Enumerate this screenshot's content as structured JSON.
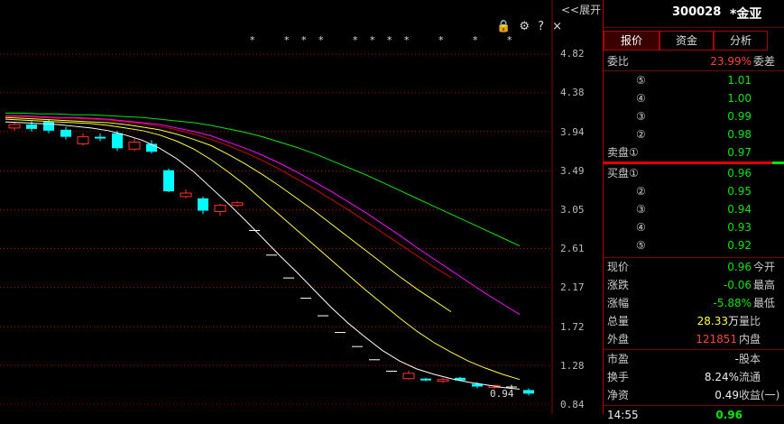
{
  "toolbar": {
    "collapse_label": "<<展开",
    "lock_icon": "lock-icon",
    "gear_icon": "gear-icon",
    "help_label": "?",
    "close_label": "×"
  },
  "markers": {
    "symbol": "*"
  },
  "price_axis": {
    "ticks": [
      "4.82",
      "4.38",
      "3.94",
      "3.49",
      "3.05",
      "2.61",
      "2.17",
      "1.72",
      "1.28",
      "0.84"
    ]
  },
  "last_price_label": "0.94",
  "colors": {
    "up": "#ff3030",
    "down": "#00ffff",
    "ma1": "#ffffff",
    "ma2": "#ffff33",
    "ma3": "#ff00ff",
    "ma4": "#00e600",
    "ma5": "#d00000"
  },
  "chart_data": {
    "type": "candlestick",
    "ylim": [
      0.84,
      4.82
    ],
    "y_ticks": [
      4.82,
      4.38,
      3.94,
      3.49,
      3.05,
      2.61,
      2.17,
      1.72,
      1.28,
      0.84
    ],
    "candles": [
      {
        "o": 3.98,
        "c": 4.02,
        "h": 4.05,
        "l": 3.95
      },
      {
        "o": 4.02,
        "c": 3.97,
        "h": 4.06,
        "l": 3.94
      },
      {
        "o": 4.05,
        "c": 3.95,
        "h": 4.08,
        "l": 3.92
      },
      {
        "o": 3.96,
        "c": 3.88,
        "h": 3.99,
        "l": 3.85
      },
      {
        "o": 3.8,
        "c": 3.88,
        "h": 3.92,
        "l": 3.78
      },
      {
        "o": 3.88,
        "c": 3.86,
        "h": 3.92,
        "l": 3.83
      },
      {
        "o": 3.92,
        "c": 3.75,
        "h": 3.95,
        "l": 3.72
      },
      {
        "o": 3.74,
        "c": 3.82,
        "h": 3.86,
        "l": 3.72
      },
      {
        "o": 3.8,
        "c": 3.71,
        "h": 3.84,
        "l": 3.69
      },
      {
        "o": 3.5,
        "c": 3.26,
        "h": 3.52,
        "l": 3.25
      },
      {
        "o": 3.2,
        "c": 3.24,
        "h": 3.28,
        "l": 3.18
      },
      {
        "o": 3.18,
        "c": 3.04,
        "h": 3.2,
        "l": 3.0
      },
      {
        "o": 3.03,
        "c": 3.1,
        "h": 3.12,
        "l": 2.98
      },
      {
        "o": 3.1,
        "c": 3.13,
        "h": 3.15,
        "l": 3.08
      },
      {
        "o": 2.82,
        "c": 2.82,
        "h": 2.82,
        "l": 2.82
      },
      {
        "o": 2.54,
        "c": 2.54,
        "h": 2.54,
        "l": 2.54
      },
      {
        "o": 2.28,
        "c": 2.28,
        "h": 2.28,
        "l": 2.28
      },
      {
        "o": 2.05,
        "c": 2.05,
        "h": 2.05,
        "l": 2.05
      },
      {
        "o": 1.85,
        "c": 1.85,
        "h": 1.85,
        "l": 1.85
      },
      {
        "o": 1.66,
        "c": 1.66,
        "h": 1.66,
        "l": 1.66
      },
      {
        "o": 1.5,
        "c": 1.5,
        "h": 1.5,
        "l": 1.5
      },
      {
        "o": 1.35,
        "c": 1.35,
        "h": 1.35,
        "l": 1.35
      },
      {
        "o": 1.22,
        "c": 1.22,
        "h": 1.22,
        "l": 1.22
      },
      {
        "o": 1.13,
        "c": 1.19,
        "h": 1.22,
        "l": 1.12
      },
      {
        "o": 1.13,
        "c": 1.11,
        "h": 1.14,
        "l": 1.1
      },
      {
        "o": 1.1,
        "c": 1.12,
        "h": 1.14,
        "l": 1.08
      },
      {
        "o": 1.14,
        "c": 1.11,
        "h": 1.15,
        "l": 1.1
      },
      {
        "o": 1.07,
        "c": 1.04,
        "h": 1.09,
        "l": 1.02
      },
      {
        "o": 1.03,
        "c": 1.05,
        "h": 1.06,
        "l": 1.01
      },
      {
        "o": 1.04,
        "c": 1.04,
        "h": 1.06,
        "l": 1.02
      },
      {
        "o": 1.0,
        "c": 0.96,
        "h": 1.02,
        "l": 0.94
      }
    ],
    "ma_lines": [
      {
        "color": "#ffffff",
        "values": [
          4.05,
          4.04,
          4.03,
          4.02,
          4.0,
          3.98,
          3.95,
          3.9,
          3.84,
          3.75,
          3.63,
          3.48,
          3.3,
          3.12,
          2.93,
          2.73,
          2.53,
          2.34,
          2.14,
          1.94,
          1.76,
          1.6,
          1.45,
          1.33,
          1.24,
          1.18,
          1.13,
          1.09,
          1.06,
          1.03,
          1.01
        ]
      },
      {
        "color": "#ffff33",
        "values": [
          4.08,
          4.07,
          4.06,
          4.05,
          4.04,
          4.03,
          4.01,
          3.98,
          3.95,
          3.9,
          3.83,
          3.74,
          3.62,
          3.48,
          3.33,
          3.16,
          2.99,
          2.82,
          2.65,
          2.48,
          2.31,
          2.14,
          1.98,
          1.82,
          1.67,
          1.54,
          1.43,
          1.33,
          1.25,
          1.18,
          1.12
        ]
      },
      {
        "color": "#ffff33",
        "values": [
          4.1,
          4.09,
          4.08,
          4.07,
          4.06,
          4.05,
          4.04,
          4.02,
          3.99,
          3.96,
          3.91,
          3.85,
          3.78,
          3.68,
          3.57,
          3.45,
          3.32,
          3.18,
          3.04,
          2.89,
          2.74,
          2.59,
          2.44,
          2.29,
          2.15,
          2.02,
          1.89
        ]
      },
      {
        "color": "#d00000",
        "values": [
          4.11,
          4.11,
          4.1,
          4.09,
          4.09,
          4.08,
          4.07,
          4.05,
          4.03,
          4.0,
          3.96,
          3.91,
          3.85,
          3.78,
          3.7,
          3.61,
          3.51,
          3.4,
          3.29,
          3.17,
          3.05,
          2.92,
          2.79,
          2.66,
          2.53,
          2.4,
          2.28
        ]
      },
      {
        "color": "#ff00ff",
        "values": [
          4.12,
          4.12,
          4.11,
          4.1,
          4.1,
          4.09,
          4.08,
          4.06,
          4.04,
          4.02,
          3.98,
          3.94,
          3.89,
          3.82,
          3.75,
          3.67,
          3.58,
          3.48,
          3.37,
          3.26,
          3.14,
          3.02,
          2.89,
          2.76,
          2.62,
          2.49,
          2.36,
          2.23,
          2.1,
          1.98,
          1.86
        ]
      },
      {
        "color": "#00e600",
        "values": [
          4.15,
          4.15,
          4.14,
          4.14,
          4.13,
          4.13,
          4.12,
          4.11,
          4.1,
          4.08,
          4.06,
          4.04,
          4.01,
          3.97,
          3.93,
          3.88,
          3.82,
          3.76,
          3.69,
          3.61,
          3.53,
          3.45,
          3.36,
          3.27,
          3.18,
          3.09,
          3.0,
          2.91,
          2.82,
          2.73,
          2.64
        ]
      }
    ]
  },
  "panel": {
    "code": "300028",
    "name": "*金亚",
    "tabs": [
      "报价",
      "资金",
      "分析"
    ],
    "weibi_label": "委比",
    "weibi_value": "23.99%",
    "weicha_label": "委差",
    "sell": [
      {
        "idx": "⑤",
        "price": "1.01"
      },
      {
        "idx": "④",
        "price": "1.00"
      },
      {
        "idx": "③",
        "price": "0.99"
      },
      {
        "idx": "②",
        "price": "0.98"
      },
      {
        "idx": "卖盘①",
        "price": "0.97"
      }
    ],
    "buy": [
      {
        "idx": "买盘①",
        "price": "0.96"
      },
      {
        "idx": "②",
        "price": "0.95"
      },
      {
        "idx": "③",
        "price": "0.94"
      },
      {
        "idx": "④",
        "price": "0.93"
      },
      {
        "idx": "⑤",
        "price": "0.92"
      }
    ],
    "stats": [
      {
        "label": "现价",
        "value": "0.96",
        "unit": "",
        "right": "今开",
        "color": "green"
      },
      {
        "label": "涨跌",
        "value": "-0.06",
        "unit": "",
        "right": "最高",
        "color": "green"
      },
      {
        "label": "涨幅",
        "value": "-5.88%",
        "unit": "",
        "right": "最低",
        "color": "green"
      },
      {
        "label": "总量",
        "value": "28.33",
        "unit": "万",
        "right": "量比",
        "color": "yellow"
      },
      {
        "label": "外盘",
        "value": "121851",
        "unit": "",
        "right": "内盘",
        "color": "red"
      }
    ],
    "stats2": [
      {
        "label": "市盈",
        "value": "-",
        "right": "股本"
      },
      {
        "label": "换手",
        "value": "8.24%",
        "right": "流通"
      },
      {
        "label": "净资",
        "value": "0.49",
        "right": "收益(一)"
      }
    ],
    "time": "14:55",
    "time_price": "0.96"
  }
}
